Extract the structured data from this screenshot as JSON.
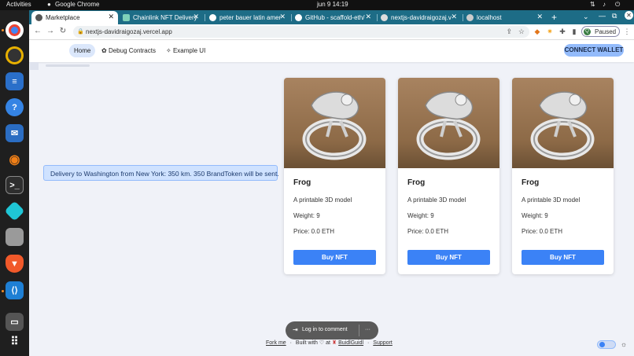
{
  "system_bar": {
    "activities": "Activities",
    "app_name": "Google Chrome",
    "datetime": "jun 9  14:19"
  },
  "browser": {
    "tabs": [
      {
        "label": "Marketplace",
        "active": true
      },
      {
        "label": "Chainlink NFT Delivery",
        "active": false
      },
      {
        "label": "peter bauer latin amer",
        "active": false
      },
      {
        "label": "GitHub - scaffold-eth/",
        "active": false
      },
      {
        "label": "nextjs-davidraigozaj.v",
        "active": false
      },
      {
        "label": "localhost",
        "active": false
      }
    ],
    "url": "nextjs-davidraigozaj.vercel.app",
    "profile_status": "Paused",
    "profile_initial": "Q"
  },
  "app": {
    "nav": {
      "home": "Home",
      "debug": "Debug Contracts",
      "example": "Example UI"
    },
    "connect_wallet": "CONNECT WALLET",
    "alert": "Delivery to Washington from New York: 350 km. 350 BrandToken will be sent.",
    "cards": [
      {
        "title": "Frog",
        "description": "A printable 3D model",
        "weight": "Weight: 9",
        "price": "Price: 0.0 ETH",
        "button": "Buy NFT"
      },
      {
        "title": "Frog",
        "description": "A printable 3D model",
        "weight": "Weight: 9",
        "price": "Price: 0.0 ETH",
        "button": "Buy NFT"
      },
      {
        "title": "Frog",
        "description": "A printable 3D model",
        "weight": "Weight: 9",
        "price": "Price: 0.0 ETH",
        "button": "Buy NFT"
      }
    ],
    "login_comment": "Log in to comment",
    "more": "···",
    "footer": {
      "fork": "Fork me",
      "sep1": "·",
      "built": "Built with ♡ at",
      "buidl": "BuidlGuidl",
      "sep2": "·",
      "support": "Support"
    }
  }
}
